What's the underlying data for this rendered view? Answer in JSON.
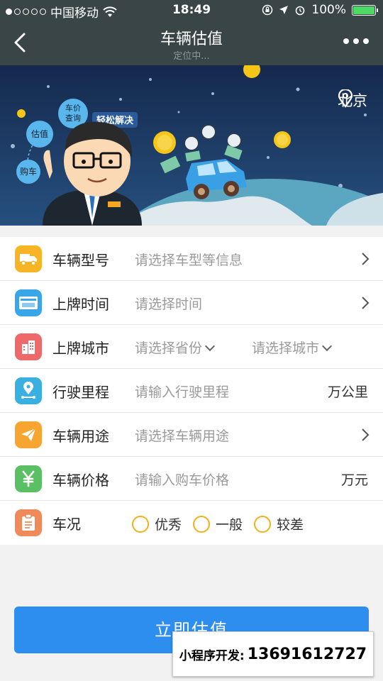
{
  "status_bar": {
    "carrier": "中国移动",
    "time": "18:49",
    "battery": "100%"
  },
  "nav": {
    "title": "车辆估值",
    "subtitle": "定位中..."
  },
  "banner": {
    "city": "北京",
    "bubbles": [
      "车价查询",
      "估值",
      "购车"
    ],
    "slogan": "轻松解决"
  },
  "form": {
    "rows": [
      {
        "label": "车辆型号",
        "placeholder": "请选择车型等信息",
        "icon": "truck-icon",
        "color": "#f7b525"
      },
      {
        "label": "上牌时间",
        "placeholder": "请选择时间",
        "icon": "license-plate-icon",
        "color": "#3aa6ea"
      },
      {
        "label": "上牌城市",
        "placeholder": "请选择省份",
        "placeholder2": "请选择城市",
        "icon": "building-icon",
        "color": "#ee6a6a"
      },
      {
        "label": "行驶里程",
        "placeholder": "请输入行驶里程",
        "unit": "万公里",
        "icon": "route-icon",
        "color": "#39b0e0"
      },
      {
        "label": "车辆用途",
        "placeholder": "请选择车辆用途",
        "icon": "paper-plane-icon",
        "color": "#f7a531"
      },
      {
        "label": "车辆价格",
        "placeholder": "请输入购车价格",
        "unit": "万元",
        "icon": "yen-icon",
        "color": "#5bc064"
      },
      {
        "label": "车况",
        "options": [
          "优秀",
          "一般",
          "较差"
        ],
        "icon": "clipboard-icon",
        "color": "#f18a5a"
      }
    ]
  },
  "submit_label": "立即估值",
  "watermark": {
    "prefix": "小程序开发:",
    "phone": "13691612727"
  }
}
